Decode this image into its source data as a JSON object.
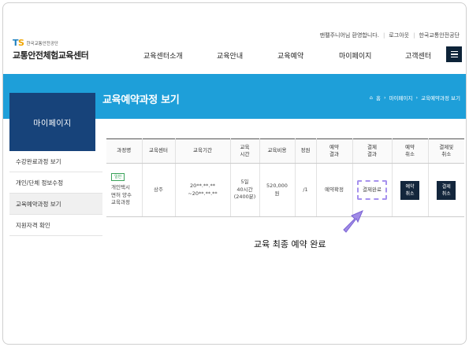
{
  "utility": {
    "greeting": "맨펠주니어님 환영합니다.",
    "logout": "로그아웃",
    "org_link": "한국교통안전공단"
  },
  "logo": {
    "mark": "TS",
    "org": "한국교통안전공단",
    "name": "교통안전체험교육센터"
  },
  "nav": {
    "items": [
      "교육센터소개",
      "교육안내",
      "교육예약",
      "마이페이지",
      "고객센터"
    ]
  },
  "banner": {
    "title": "교육예약과정 보기",
    "breadcrumb": [
      "홈",
      "마이페이지",
      "교육예약과정 보기"
    ]
  },
  "sidebar": {
    "title": "마이페이지",
    "items": [
      "수강완료과정 보기",
      "개인/단체 정보수정",
      "교육예약과정 보기",
      "지원자격 확인"
    ],
    "active_index": 2
  },
  "table": {
    "headers": [
      "과정명",
      "교육센터",
      "교육기간",
      "교육\n시간",
      "교육비용",
      "정원",
      "예약\n결과",
      "결제\n결과",
      "예약\n취소",
      "결제및\n취소"
    ],
    "row": {
      "tag": "일반",
      "course": "개인택시\n면허 양수\n교육과정",
      "center": "상주",
      "period": "20**.**.**\n~20**.**.**",
      "hours": "5일\n40시간\n(2400분)",
      "fee": "520,000\n원",
      "capacity": "/1",
      "reserve_result": "예약확정",
      "payment_result": "결제완료",
      "reserve_cancel_btn": "예약\n취소",
      "pay_cancel_btn": "결제\n취소"
    }
  },
  "annotation": {
    "caption": "교육 최종 예약 완료"
  },
  "colors": {
    "banner": "#1e9fd9",
    "sidebar_head": "#17437a",
    "button_dark": "#13263c",
    "highlight": "#a691ee"
  }
}
